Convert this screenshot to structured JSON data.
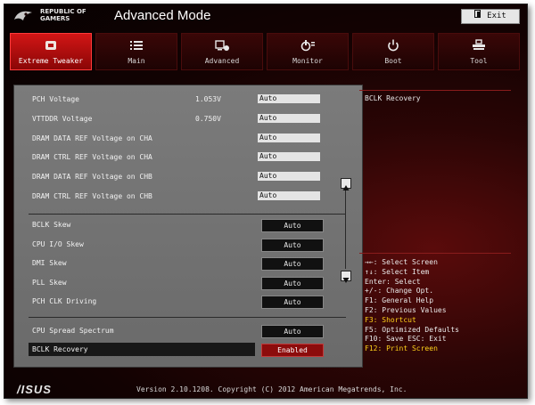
{
  "header": {
    "brand_line1": "REPUBLIC OF",
    "brand_line2": "GAMERS",
    "title": "Advanced Mode",
    "exit_label": "Exit"
  },
  "tabs": [
    {
      "label": "Extreme Tweaker",
      "icon": "chip-icon",
      "active": true
    },
    {
      "label": "Main",
      "icon": "list-icon",
      "active": false
    },
    {
      "label": "Advanced",
      "icon": "advanced-settings-icon",
      "active": false
    },
    {
      "label": "Monitor",
      "icon": "monitor-gauge-icon",
      "active": false
    },
    {
      "label": "Boot",
      "icon": "power-icon",
      "active": false
    },
    {
      "label": "Tool",
      "icon": "tool-icon",
      "active": false
    }
  ],
  "settings": [
    {
      "label": "PCH Voltage",
      "value": "1.053V",
      "control": "Auto"
    },
    {
      "label": "VTTDDR Voltage",
      "value": "0.750V",
      "control": "Auto"
    },
    {
      "label": "DRAM DATA REF Voltage on CHA",
      "value": "",
      "control": "Auto"
    },
    {
      "label": "DRAM CTRL REF Voltage on CHA",
      "value": "",
      "control": "Auto"
    },
    {
      "label": "DRAM DATA REF Voltage on CHB",
      "value": "",
      "control": "Auto"
    },
    {
      "label": "DRAM CTRL REF Voltage on CHB",
      "value": "",
      "control": "Auto"
    },
    {
      "label": "BCLK Skew",
      "value": "",
      "control": "Auto"
    },
    {
      "label": "CPU I/O Skew",
      "value": "",
      "control": "Auto"
    },
    {
      "label": "DMI Skew",
      "value": "",
      "control": "Auto"
    },
    {
      "label": "PLL Skew",
      "value": "",
      "control": "Auto"
    },
    {
      "label": "PCH CLK Driving",
      "value": "",
      "control": "Auto"
    },
    {
      "label": "CPU Spread Spectrum",
      "value": "",
      "control": "Auto"
    },
    {
      "label": "BCLK Recovery",
      "value": "",
      "control": "Enabled"
    }
  ],
  "help": {
    "title": "BCLK Recovery"
  },
  "keys": [
    {
      "text": "→←: Select Screen",
      "highlight": false
    },
    {
      "text": "↑↓: Select Item",
      "highlight": false
    },
    {
      "text": "Enter: Select",
      "highlight": false
    },
    {
      "text": "+/-: Change Opt.",
      "highlight": false
    },
    {
      "text": "F1: General Help",
      "highlight": false
    },
    {
      "text": "F2: Previous Values",
      "highlight": false
    },
    {
      "text": "F3: Shortcut",
      "highlight": true
    },
    {
      "text": "F5: Optimized Defaults",
      "highlight": false
    },
    {
      "text": "F10: Save  ESC: Exit",
      "highlight": false
    },
    {
      "text": "F12: Print Screen",
      "highlight": true
    }
  ],
  "footer": {
    "logo": "/ISUS",
    "text": "Version 2.10.1208. Copyright (C) 2012 American Megatrends, Inc."
  },
  "colors": {
    "accent": "#d21616",
    "highlight_text": "#ffd21a",
    "enabled_box": "#8c0c0c"
  }
}
